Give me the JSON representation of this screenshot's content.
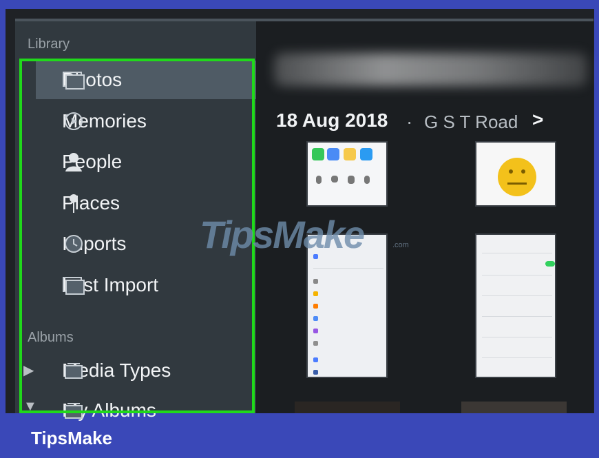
{
  "sidebar": {
    "library_label": "Library",
    "items": [
      {
        "label": "Photos",
        "icon": "photos-icon"
      },
      {
        "label": "Memories",
        "icon": "memories-icon"
      },
      {
        "label": "People",
        "icon": "people-icon"
      },
      {
        "label": "Places",
        "icon": "places-icon"
      },
      {
        "label": "Imports",
        "icon": "imports-icon"
      },
      {
        "label": "Last Import",
        "icon": "last-import-icon"
      }
    ],
    "albums_label": "Albums",
    "albums": [
      {
        "label": "Media Types",
        "icon": "album-icon"
      },
      {
        "label": "My Albums",
        "icon": "album-icon"
      }
    ]
  },
  "main": {
    "date": "18 Aug 2018",
    "separator": "·",
    "place": "G S T Road",
    "chevron": ">"
  },
  "watermark": "TipsMake",
  "watermark_small": ".com",
  "brand": "TipsMake",
  "colors": {
    "frame": "#3a48b8",
    "selection_outline": "#20d91b",
    "sidebar": "#31393f",
    "selected_row": "#4f5b65",
    "toggle": "#32d15e"
  }
}
